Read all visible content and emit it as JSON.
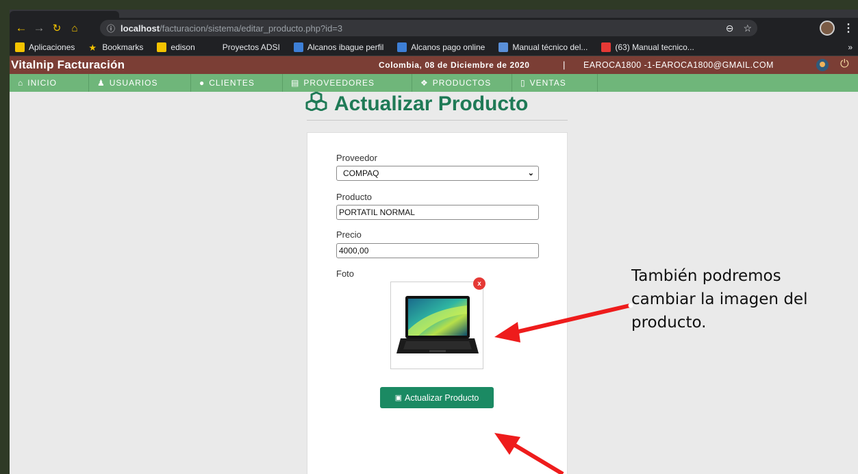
{
  "browser": {
    "url_host": "localhost",
    "url_path": "/facturacion/sistema/editar_producto.php?id=3",
    "bookmarks": [
      {
        "label": "Aplicaciones",
        "icon": "apps-grid-icon",
        "color": "#f4c300"
      },
      {
        "label": "Bookmarks",
        "icon": "star-icon",
        "color": "#f4c300"
      },
      {
        "label": "edison",
        "icon": "folder-icon",
        "color": "#f4c300"
      },
      {
        "label": "Proyectos ADSI",
        "icon": "blank-icon",
        "color": "#202124"
      },
      {
        "label": "Alcanos ibague perfil",
        "icon": "alcanos-icon",
        "color": "#3d7fd6"
      },
      {
        "label": "Alcanos pago online",
        "icon": "alcanos-icon",
        "color": "#3d7fd6"
      },
      {
        "label": "Manual técnico del...",
        "icon": "doc-icon",
        "color": "#5a8fd8"
      },
      {
        "label": "(63) Manual tecnico...",
        "icon": "youtube-icon",
        "color": "#e53935"
      }
    ],
    "more_label": "»"
  },
  "header": {
    "brand": "Vitalnip Facturación",
    "date": "Colombia, 08 de Diciembre de 2020",
    "separator": "|",
    "user": "EAROCA1800 -1-EAROCA1800@GMAIL.COM"
  },
  "menu": [
    {
      "label": "INICIO",
      "icon": "home-icon",
      "glyph": "⌂"
    },
    {
      "label": "USUARIOS",
      "icon": "users-icon",
      "glyph": "♟"
    },
    {
      "label": "CLIENTES",
      "icon": "user-icon",
      "glyph": "●"
    },
    {
      "label": "PROVEEDORES",
      "icon": "building-icon",
      "glyph": "▤"
    },
    {
      "label": "PRODUCTOS",
      "icon": "cubes-icon",
      "glyph": "❖"
    },
    {
      "label": "VENTAS",
      "icon": "file-icon",
      "glyph": "▯"
    }
  ],
  "form": {
    "title": "Actualizar Producto",
    "proveedor_label": "Proveedor",
    "proveedor_value": "COMPAQ",
    "producto_label": "Producto",
    "producto_value": "PORTATIL NORMAL",
    "precio_label": "Precio",
    "precio_value": "4000,00",
    "foto_label": "Foto",
    "remove_photo": "x",
    "submit_label": "Actualizar Producto"
  },
  "annotation": {
    "text_line1": "También podremos",
    "text_line2": "cambiar la imagen del",
    "text_line3": "producto.",
    "arrow_color": "#ee1c1c"
  }
}
